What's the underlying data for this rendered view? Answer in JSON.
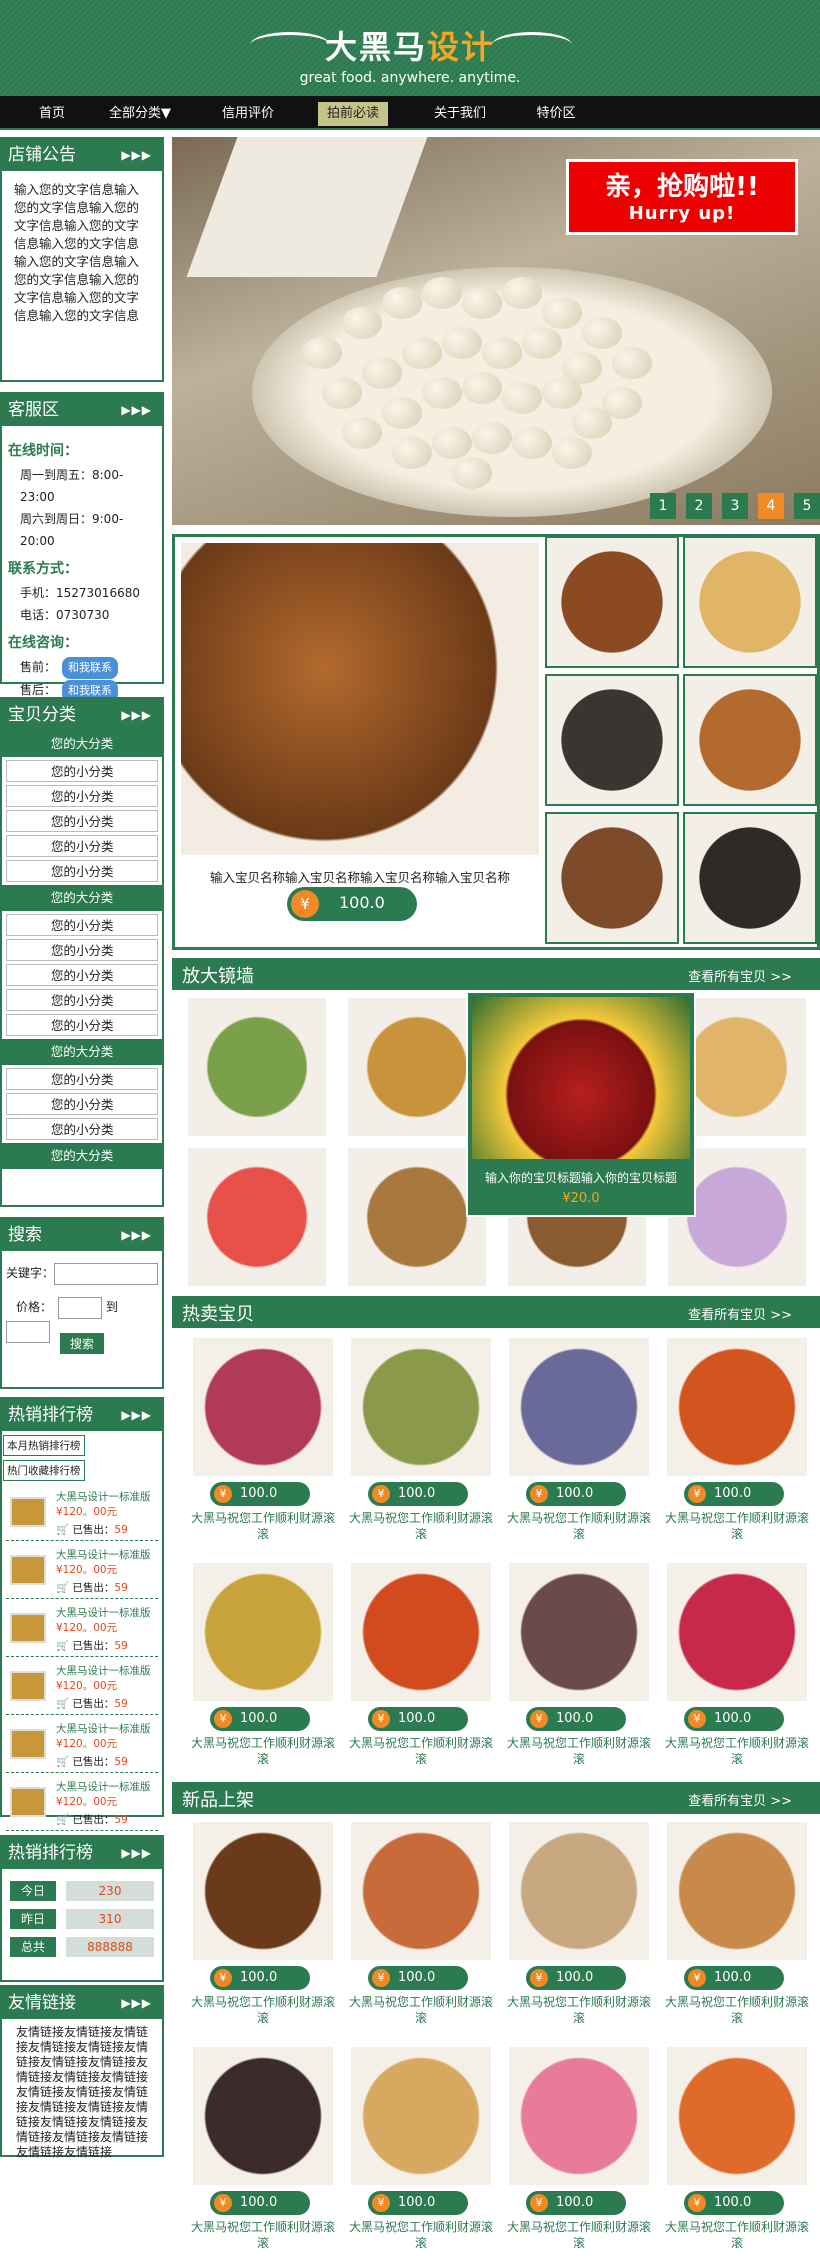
{
  "brand": {
    "name_a": "大黑马",
    "name_b": "设计",
    "slogan": "great food. anywhere. anytime."
  },
  "nav": [
    "首页",
    "全部分类▼",
    "信用评价",
    "拍前必读",
    "关于我们",
    "特价区"
  ],
  "notice": {
    "title": "店铺公告",
    "arrows": "▶▶▶",
    "text": "输入您的文字信息输入您的文字信息输入您的文字信息输入您的文字信息输入您的文字信息输入您的文字信息输入您的文字信息输入您的文字信息输入您的文字信息输入您的文字信息"
  },
  "service": {
    "title": "客服区",
    "online_h": "在线时间：",
    "weekday": "周一到周五：8:00-23:00",
    "weekend": "周六到周日：9:00-20:00",
    "contact_h": "联系方式：",
    "phone": "手机：15273016680",
    "tel": "电话：0730730",
    "consult_h": "在线咨询：",
    "pre": "售前：",
    "post": "售后：",
    "qq": "和我联系"
  },
  "category": {
    "title": "宝贝分类",
    "big": "您的大分类",
    "small": "您的小分类"
  },
  "search": {
    "title": "搜索",
    "kw": "关键字：",
    "price": "价格：",
    "to": "到",
    "btn": "搜索"
  },
  "hotrank": {
    "title": "热销排行榜",
    "tab1": "本月热销排行榜",
    "tab2": "热门收藏排行榜",
    "item": "大黑马设计一标准版",
    "price": "¥120。00元",
    "sold_label": "已售出：",
    "sold": "59"
  },
  "stats": {
    "title": "热销排行榜",
    "rows": [
      {
        "label": "今日",
        "value": "230"
      },
      {
        "label": "昨日",
        "value": "310"
      },
      {
        "label": "总共",
        "value": "888888"
      }
    ]
  },
  "links": {
    "title": "友情链接",
    "text": "友情链接友情链接友情链接友情链接友情链接友情链接友情链接友情链接友情链接友情链接友情链接友情链接友情链接友情链接友情链接友情链接友情链接友情链接友情链接友情链接友情链接友情链接友情链接友情链接"
  },
  "banner": {
    "line1": "亲，抢购啦!!",
    "line2": "Hurry up!",
    "pages": [
      "1",
      "2",
      "3",
      "4",
      "5"
    ]
  },
  "feature": {
    "title": "输入宝贝名称输入宝贝名称输入宝贝名称输入宝贝名称",
    "price": "100.0",
    "currency": "¥"
  },
  "magnify": {
    "title": "放大镜墙",
    "more": "查看所有宝贝 >>",
    "hover_title": "输入你的宝贝标题输入你的宝贝标题",
    "hover_price": "¥20.0"
  },
  "hot": {
    "title": "热卖宝贝",
    "more": "查看所有宝贝 >>",
    "price": "100.0",
    "name": "大黑马祝您工作顺利财源滚滚"
  },
  "newp": {
    "title": "新品上架",
    "more": "查看所有宝贝 >>",
    "price": "100.0",
    "name": "大黑马祝您工作顺利财源滚滚"
  },
  "colors": {
    "green": "#2c7a50",
    "orange": "#f08a24",
    "red": "#e00000"
  }
}
